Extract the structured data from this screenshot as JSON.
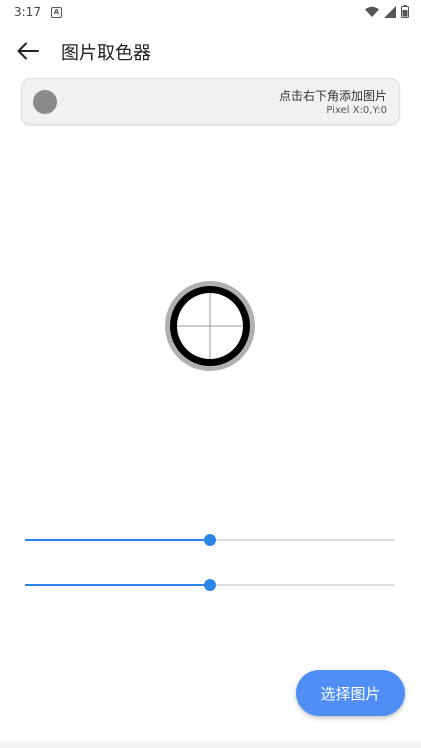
{
  "status_bar": {
    "time": "3:17",
    "notification_icon": "a-badge-icon",
    "icons": [
      "wifi-icon",
      "cellular-icon",
      "battery-icon"
    ]
  },
  "app_bar": {
    "back_icon": "arrow-left-icon",
    "title": "图片取色器"
  },
  "color_card": {
    "swatch_color": "#8a8a8a",
    "hint": "点击右下角添加图片",
    "pixel": "Pixel X:0,Y:0"
  },
  "sliders": [
    {
      "value_fraction": 0.5
    },
    {
      "value_fraction": 0.5
    }
  ],
  "fab": {
    "label": "选择图片",
    "color": "#4f8ef5"
  },
  "colors": {
    "accent": "#2d86e6",
    "picker_ring": "#000000",
    "picker_outer": "#b0b0b0"
  }
}
